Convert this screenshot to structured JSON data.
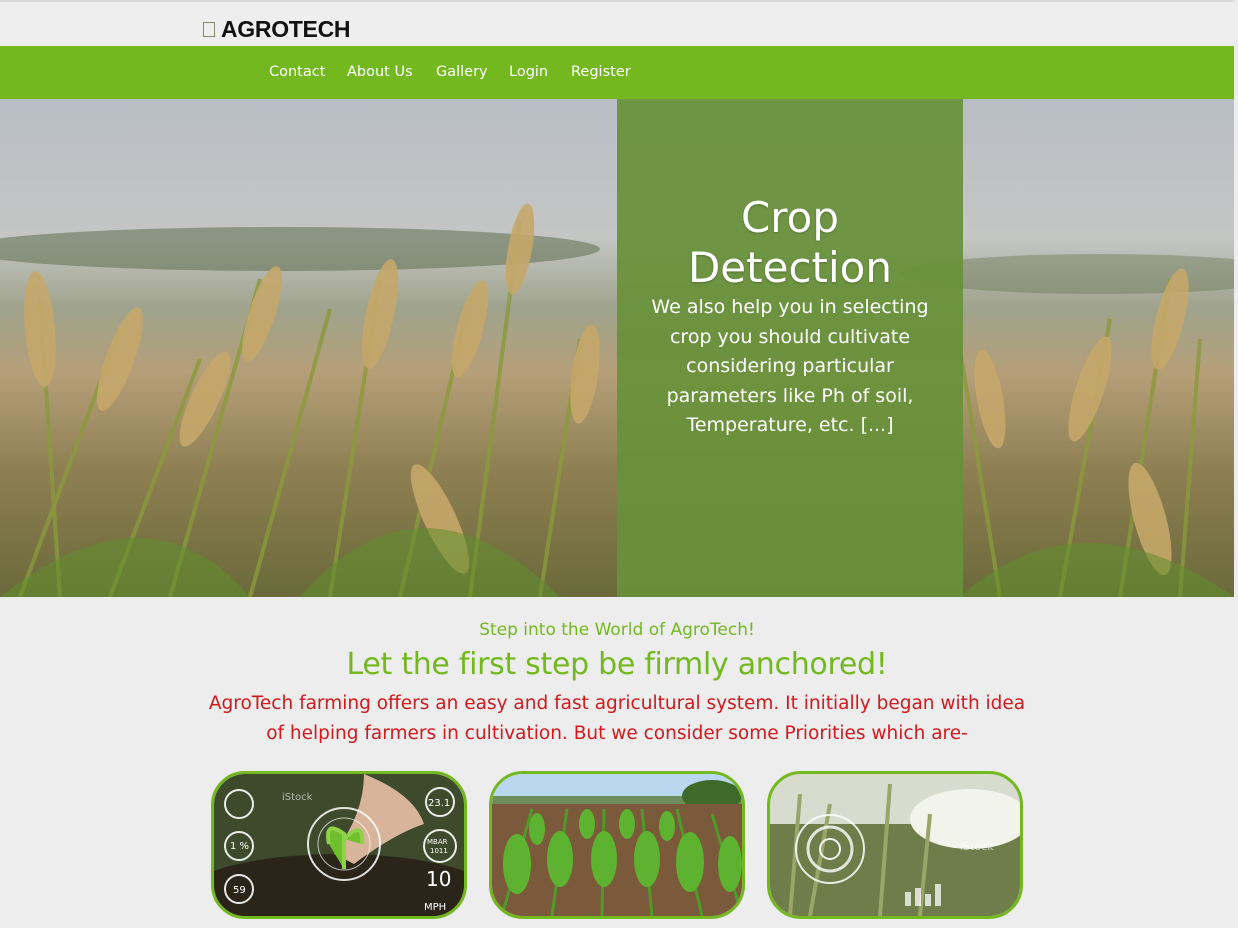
{
  "header": {
    "brand": "AGROTECH"
  },
  "nav": {
    "items": [
      "Contact",
      "About Us",
      "Gallery",
      "Login",
      "Register"
    ]
  },
  "hero": {
    "title_line1": "Crop",
    "title_line2": "Detection",
    "description": "We also help you in selecting crop you should cultivate considering particular parameters like Ph of soil, Temperature, etc. [...]"
  },
  "intro": {
    "subtitle": "Step into the World of AgroTech!",
    "heading": "Let the first step be firmly anchored!",
    "text": "AgroTech farming offers an easy and fast agricultural system. It initially began with idea of helping farmers in cultivation. But we consider some Priorities which are-"
  },
  "cards": {
    "card1": {
      "overlay": [
        "iStock",
        "23.1",
        "MBAR",
        "1011",
        "1 %",
        "59",
        "10",
        "MPH"
      ]
    },
    "card3": {
      "overlay": [
        "iStock"
      ]
    }
  },
  "colors": {
    "accent": "#74b81f",
    "panel": "#68913a",
    "alert_text": "#d4181c",
    "background": "#ededed"
  }
}
